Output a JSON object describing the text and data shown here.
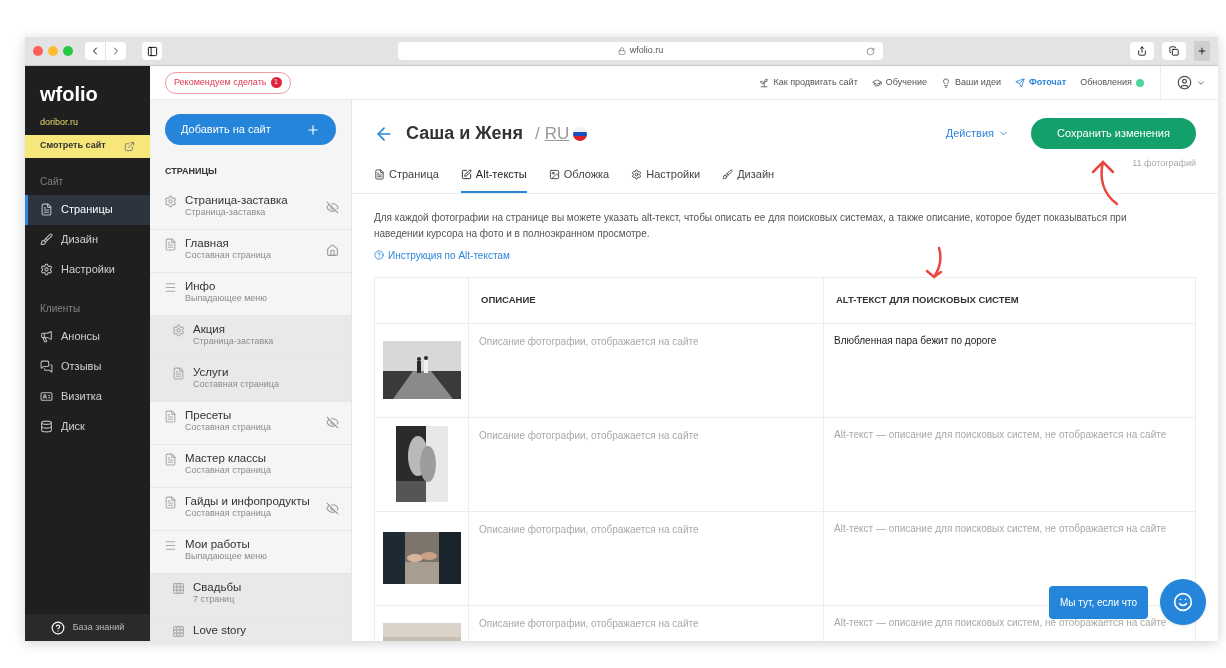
{
  "browser": {
    "url": "wfolio.ru"
  },
  "sidebar": {
    "logo": "wfolio",
    "domain": "doribor.ru",
    "view_site": "Смотреть сайт",
    "sections": [
      {
        "title": "Сайт",
        "items": [
          {
            "label": "Страницы",
            "selected": true
          },
          {
            "label": "Дизайн",
            "selected": false
          },
          {
            "label": "Настройки",
            "selected": false
          }
        ]
      },
      {
        "title": "Клиенты",
        "items": [
          {
            "label": "Анонсы",
            "selected": false
          },
          {
            "label": "Отзывы",
            "selected": false
          },
          {
            "label": "Визитка",
            "selected": false
          },
          {
            "label": "Диск",
            "selected": false
          }
        ]
      }
    ],
    "help": "База знаний"
  },
  "topbar": {
    "recommend": {
      "label": "Рекомендуем сделать",
      "count": "1"
    },
    "links": [
      {
        "label": "Как продвигать сайт",
        "accent": false
      },
      {
        "label": "Обучение",
        "accent": false
      },
      {
        "label": "Ваши идеи",
        "accent": false
      },
      {
        "label": "Фоточат",
        "accent": true
      },
      {
        "label": "Обновления",
        "accent": false,
        "status_dot": {
          "color": "#4fd69c"
        }
      }
    ]
  },
  "pages_panel": {
    "add_button": "Добавить на сайт",
    "heading": "СТРАНИЦЫ",
    "items": [
      {
        "title": "Страница-заставка",
        "subtitle": "Страница-заставка",
        "kind": "splash",
        "hidden": true,
        "home": false
      },
      {
        "title": "Главная",
        "subtitle": "Составная страница",
        "kind": "composite",
        "hidden": false,
        "home": true
      },
      {
        "title": "Инфо",
        "subtitle": "Выпадающее меню",
        "kind": "dropdown",
        "hidden": false,
        "home": false,
        "children": [
          {
            "title": "Акция",
            "subtitle": "Страница-заставка",
            "kind": "splash",
            "hidden": false,
            "home": false
          },
          {
            "title": "Услуги",
            "subtitle": "Составная страница",
            "kind": "composite",
            "hidden": false,
            "home": false
          }
        ]
      },
      {
        "title": "Пресеты",
        "subtitle": "Составная страница",
        "kind": "composite",
        "hidden": true,
        "home": false
      },
      {
        "title": "Мастер классы",
        "subtitle": "Составная страница",
        "kind": "composite",
        "hidden": false,
        "home": false
      },
      {
        "title": "Гайды и инфопродукты",
        "subtitle": "Составная страница",
        "kind": "composite",
        "hidden": true,
        "home": false
      },
      {
        "title": "Мои работы",
        "subtitle": "Выпадающее меню",
        "kind": "dropdown",
        "hidden": false,
        "home": false,
        "children": [
          {
            "title": "Свадьбы",
            "subtitle": "7 страниц",
            "kind": "gallery",
            "hidden": false,
            "home": false
          },
          {
            "title": "Love story",
            "kind": "gallery",
            "hidden": false,
            "home": false
          }
        ]
      }
    ]
  },
  "main": {
    "title": "Саша и Женя",
    "separator": "/",
    "language": "RU",
    "actions": "Действия",
    "save_button": "Сохранить изменения",
    "photo_count": "11 фотографий",
    "tabs": [
      {
        "label": "Страница",
        "selected": false
      },
      {
        "label": "Alt-тексты",
        "selected": true
      },
      {
        "label": "Обложка",
        "selected": false
      },
      {
        "label": "Настройки",
        "selected": false
      },
      {
        "label": "Дизайн",
        "selected": false
      }
    ],
    "intro": "Для каждой фотографии на странице вы можете указать alt-текст, чтобы описать ее для поисковых системах, а также описание, которое будет показываться при наведении курсора на фото и в полноэкранном просмотре.",
    "help_link": "Инструкция по Alt-текстам",
    "table": {
      "columns": [
        "ОПИСАНИЕ",
        "ALT-ТЕКСТ ДЛЯ ПОИСКОВЫХ СИСТЕМ"
      ],
      "rows": [
        {
          "description": {
            "placeholder": "Описание фотографии, отображается на сайте"
          },
          "alt_text": {
            "value": "Влюбленная пара бежит по дороге"
          }
        },
        {
          "description": {
            "placeholder": "Описание фотографии, отображается на сайте"
          },
          "alt_text": {
            "placeholder": "Alt-текст — описание для поисковых систем, не отображается на сайте"
          }
        },
        {
          "description": {
            "placeholder": "Описание фотографии, отображается на сайте"
          },
          "alt_text": {
            "placeholder": "Alt-текст — описание для поисковых систем, не отображается на сайте"
          }
        },
        {
          "description": {
            "placeholder": "Описание фотографии, отображается на сайте"
          },
          "alt_text": {
            "placeholder": "Alt-текст — описание для поисковых систем, не отображается на сайте"
          }
        }
      ]
    }
  },
  "chat": {
    "label": "Мы тут, если что"
  }
}
